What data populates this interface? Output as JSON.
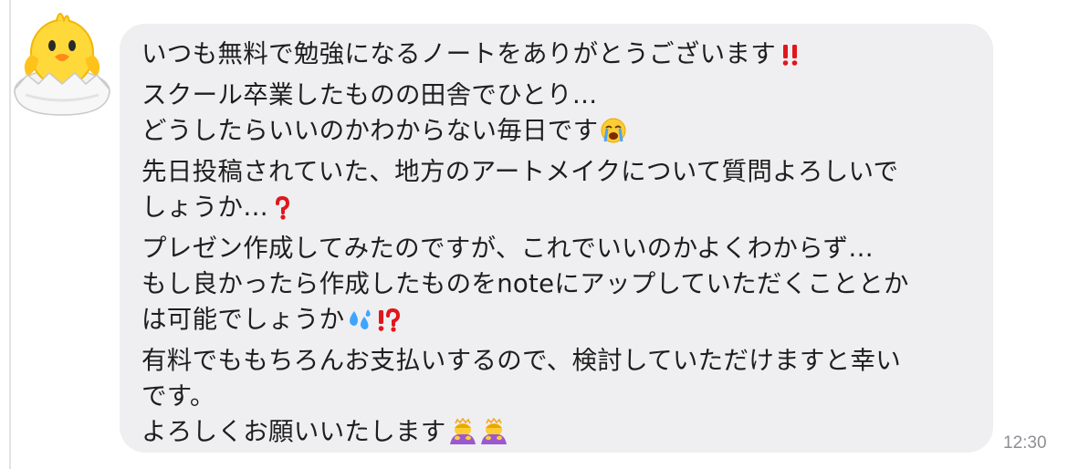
{
  "message": {
    "lines": [
      "いつも無料で勉強になるノートをありがとうございます",
      "スクール卒業したものの田舎でひとり…",
      "どうしたらいいのかわからない毎日です",
      "先日投稿されていた、地方のアートメイクについて質問よろしいで",
      "しょうか…",
      "プレゼン作成してみたのですが、これでいいのかよくわからず…",
      "もし良かったら作成したものをnoteにアップしていただくこととか",
      "は可能でしょうか",
      "有料でももちろんお支払いするので、検討していただけますと幸い",
      "です。",
      "よろしくお願いいたします"
    ],
    "timestamp": "12:30"
  },
  "icons": {
    "avatar": "hatching-chick",
    "line_end": {
      "0": [
        "double-exclamation"
      ],
      "2": [
        "crying-face"
      ],
      "4": [
        "red-question-mark"
      ],
      "7": [
        "sweat-droplets",
        "exclamation-question-mark"
      ],
      "10": [
        "person-bowing",
        "person-bowing"
      ]
    }
  },
  "colors": {
    "bubble_background": "#efeff1",
    "message_text": "#1e1e1e",
    "timestamp_text": "#8e8e93",
    "emoji_red": "#e0171c"
  }
}
